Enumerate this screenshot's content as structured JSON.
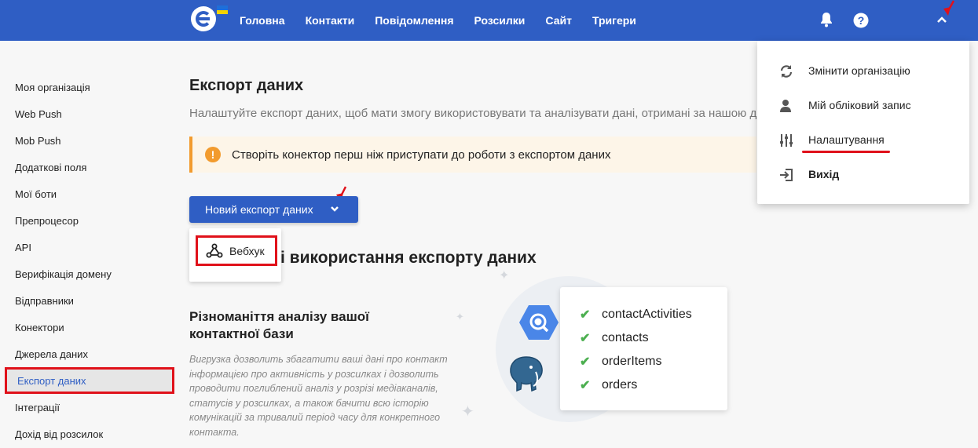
{
  "topbar": {
    "nav": [
      "Головна",
      "Контакти",
      "Повідомлення",
      "Розсилки",
      "Сайт",
      "Тригери"
    ],
    "icons": [
      "bell-icon",
      "help-icon",
      "chevron-up-icon"
    ],
    "flag_colors": [
      "#1e6fd9",
      "#f5d300"
    ]
  },
  "sidebar": {
    "items": [
      {
        "label": "Моя організація"
      },
      {
        "label": "Web Push"
      },
      {
        "label": "Mob Push"
      },
      {
        "label": "Додаткові поля"
      },
      {
        "label": "Мої боти"
      },
      {
        "label": "Препроцесор"
      },
      {
        "label": "API"
      },
      {
        "label": "Верифікація домену"
      },
      {
        "label": "Відправники"
      },
      {
        "label": "Конектори"
      },
      {
        "label": "Джерела даних"
      },
      {
        "label": "Експорт даних",
        "active": true
      },
      {
        "label": "Інтеграції"
      },
      {
        "label": "Дохід від розсилок"
      }
    ]
  },
  "main": {
    "title": "Експорт даних",
    "subtitle": "Налаштуйте експорт даних, щоб мати змогу використовувати та аналізувати дані, отримані за нашою допомогою",
    "alert": "Створіть конектор перш ніж приступати до роботи з експортом даних",
    "new_export_button": "Новий експорт даних",
    "dropdown_option": "Вебхук",
    "section_title": "і використання експорту даних",
    "feature_title": "Різноманіття аналізу вашої контактної бази",
    "feature_text": "Вигрузка дозволить збагатити ваші дані про контакт інформацією про активність у розсилках і дозволить проводити поглиблений аналіз у розрізі медіаканалів, статусів у розсилках, а також бачити всю історію комунікацій за тривалий період часу для конкретного контакта."
  },
  "illustration": {
    "items": [
      "contactActivities",
      "contacts",
      "orderItems",
      "orders"
    ]
  },
  "user_menu": {
    "items": [
      {
        "label": "Змінити організацію",
        "icon": "sync-icon"
      },
      {
        "label": "Мій обліковий запис",
        "icon": "user-icon"
      },
      {
        "label": "Налаштування",
        "icon": "sliders-icon"
      },
      {
        "label": "Вихід",
        "icon": "logout-icon"
      }
    ]
  },
  "colors": {
    "primary": "#2f5ec4",
    "highlight": "#e0111a",
    "warning": "#f29b2e",
    "success": "#4caf50"
  }
}
